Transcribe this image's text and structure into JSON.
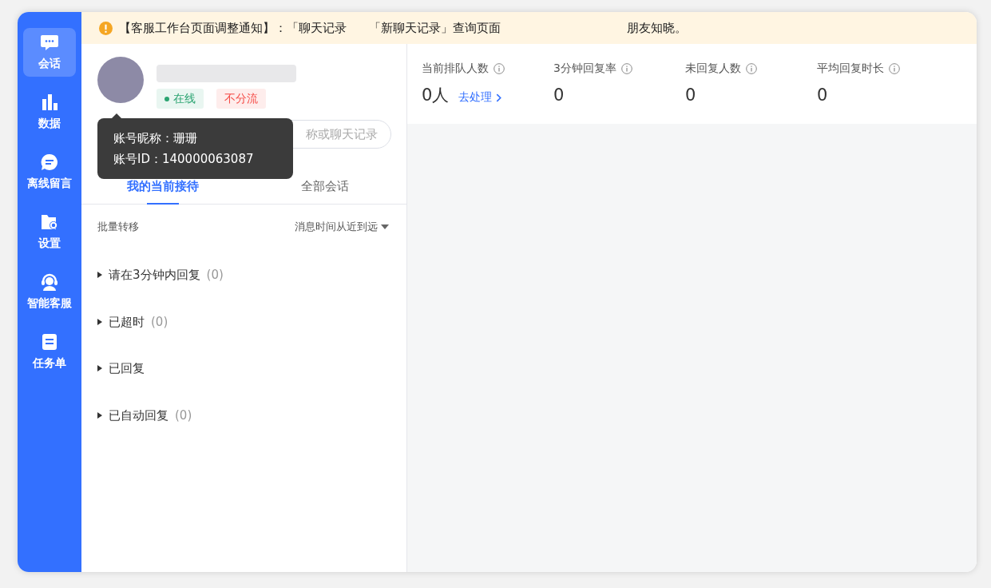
{
  "sidebar": {
    "items": [
      {
        "label": "会话",
        "selected": true
      },
      {
        "label": "数据",
        "selected": false
      },
      {
        "label": "离线留言",
        "selected": false
      },
      {
        "label": "设置",
        "selected": false
      },
      {
        "label": "智能客服",
        "selected": false
      },
      {
        "label": "任务单",
        "selected": false
      }
    ]
  },
  "notice": {
    "parts": [
      "【客服工作台页面调整通知】：「聊天记录",
      "「新聊天记录」查询页面",
      "朋友知晓。"
    ]
  },
  "profile": {
    "badges": [
      {
        "text": "在线",
        "kind": "online",
        "color": "#2ba471"
      },
      {
        "text": "不分流",
        "kind": "tag",
        "color": "#f54a45"
      }
    ]
  },
  "tooltip": {
    "lines": [
      "账号昵称：珊珊",
      "账号ID：140000063087"
    ]
  },
  "search": {
    "placeholder": "称或聊天记录"
  },
  "tabs": [
    {
      "label": "我的当前接待",
      "selected": true
    },
    {
      "label": "全部会话",
      "selected": false
    }
  ],
  "toolbar": {
    "batch": "批量转移",
    "sort": "消息时间从近到远"
  },
  "groups": [
    {
      "label": "请在3分钟内回复",
      "count": "(0)",
      "expanded": false
    },
    {
      "label": "已超时",
      "count": "(0)",
      "expanded": false
    },
    {
      "label": "已回复",
      "expanded": false
    },
    {
      "label": "已自动回复",
      "count": "(0)",
      "expanded": false
    }
  ],
  "stats": [
    {
      "label": "当前排队人数",
      "value": "0人",
      "action": "去处理"
    },
    {
      "label": "3分钟回复率",
      "value": "0"
    },
    {
      "label": "未回复人数",
      "value": "0"
    },
    {
      "label": "平均回复时长",
      "value": "0"
    }
  ]
}
